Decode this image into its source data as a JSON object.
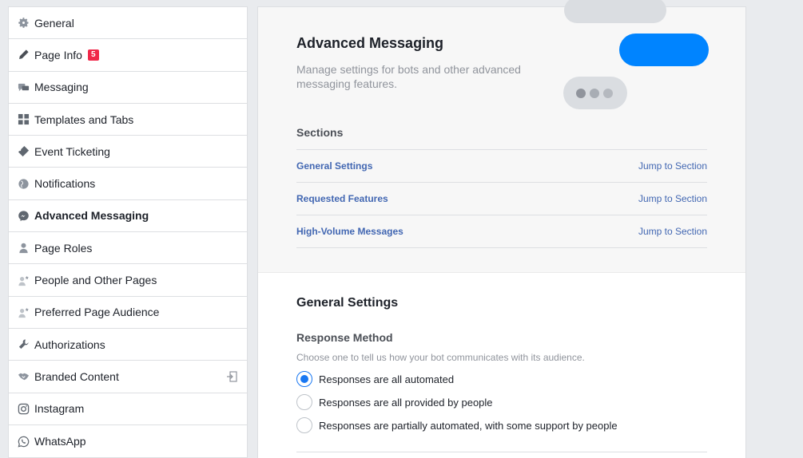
{
  "sidebar": {
    "items": [
      {
        "label": "General",
        "icon": "gear-icon"
      },
      {
        "label": "Page Info",
        "icon": "pencil-icon",
        "badge": "5"
      },
      {
        "label": "Messaging",
        "icon": "chat-bubbles-icon"
      },
      {
        "label": "Templates and Tabs",
        "icon": "grid-icon"
      },
      {
        "label": "Event Ticketing",
        "icon": "ticket-icon"
      },
      {
        "label": "Notifications",
        "icon": "globe-icon"
      },
      {
        "label": "Advanced Messaging",
        "icon": "messenger-icon",
        "active": true
      },
      {
        "label": "Page Roles",
        "icon": "person-icon"
      },
      {
        "label": "People and Other Pages",
        "icon": "person-star-icon"
      },
      {
        "label": "Preferred Page Audience",
        "icon": "person-star-icon"
      },
      {
        "label": "Authorizations",
        "icon": "wrench-icon"
      },
      {
        "label": "Branded Content",
        "icon": "handshake-icon",
        "right_icon": "enter-icon"
      },
      {
        "label": "Instagram",
        "icon": "instagram-icon"
      },
      {
        "label": "WhatsApp",
        "icon": "whatsapp-icon"
      }
    ]
  },
  "main": {
    "title": "Advanced Messaging",
    "description": "Manage settings for bots and other advanced messaging features.",
    "sections_title": "Sections",
    "sections": [
      {
        "label": "General Settings",
        "jump": "Jump to Section"
      },
      {
        "label": "Requested Features",
        "jump": "Jump to Section"
      },
      {
        "label": "High-Volume Messages",
        "jump": "Jump to Section"
      }
    ],
    "general_settings": {
      "title": "General Settings",
      "response_method": {
        "title": "Response Method",
        "description": "Choose one to tell us how your bot communicates with its audience.",
        "options": [
          {
            "label": "Responses are all automated",
            "checked": true
          },
          {
            "label": "Responses are all provided by people",
            "checked": false
          },
          {
            "label": "Responses are partially automated, with some support by people",
            "checked": false
          }
        ]
      }
    }
  },
  "colors": {
    "accent_blue": "#0084ff",
    "link_blue": "#4267b2",
    "radio_blue": "#1877f2",
    "badge_red": "#f02849"
  }
}
